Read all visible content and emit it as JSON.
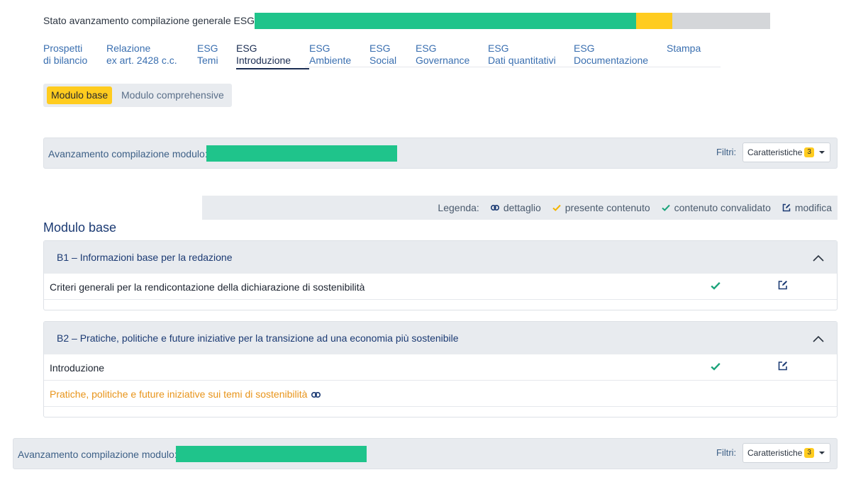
{
  "overall": {
    "label": "Stato avanzamento compilazione generale ESG:",
    "segments": [
      {
        "fraction": 0.74,
        "color": "#1fc48b"
      },
      {
        "fraction": 0.07,
        "color": "#ffcc1f"
      },
      {
        "fraction": 0.19,
        "color": "#d4d6d9"
      }
    ]
  },
  "nav": {
    "items": [
      {
        "line1": "Prospetti",
        "line2": "di bilancio"
      },
      {
        "line1": "Relazione",
        "line2": "ex art. 2428 c.c."
      },
      {
        "line1": "ESG",
        "line2": "Temi"
      },
      {
        "line1": "ESG",
        "line2": "Introduzione"
      },
      {
        "line1": "ESG",
        "line2": "Ambiente"
      },
      {
        "line1": "ESG",
        "line2": "Social"
      },
      {
        "line1": "ESG",
        "line2": "Governance"
      },
      {
        "line1": "ESG",
        "line2": "Dati quantitativi"
      },
      {
        "line1": "ESG",
        "line2": "Documentazione"
      },
      {
        "line1": "Stampa",
        "line2": ""
      }
    ],
    "active_index": 3
  },
  "module_switch": {
    "base_label": "Modulo base",
    "comprehensive_label": "Modulo comprehensive"
  },
  "module_progress": {
    "label": "Avanzamento compilazione modulo:",
    "filters_label": "Filtri:",
    "filter_value": "Caratteristiche",
    "filter_count": "3",
    "bar_color": "#1fc48b"
  },
  "legend": {
    "title": "Legenda:",
    "detail": "dettaglio",
    "present": "presente contenuto",
    "validated": "contenuto convalidato",
    "edit": "modifica"
  },
  "section": {
    "title": "Modulo base"
  },
  "cards": [
    {
      "title": "B1 – Informazioni base per la redazione",
      "rows": [
        {
          "text": "Criteri generali per la rendicontazione della dichiarazione di sostenibilità",
          "validated": true,
          "editable": true
        }
      ]
    },
    {
      "title": "B2 – Pratiche, politiche e future iniziative per la transizione ad una economia più sostenibile",
      "rows": [
        {
          "text": "Introduzione",
          "validated": true,
          "editable": true
        },
        {
          "text": "Pratiche, politiche e future iniziative sui temi di sostenibilità",
          "link": true
        }
      ]
    }
  ],
  "colors": {
    "accent_yellow": "#ffcc1f",
    "progress_green": "#1fc48b",
    "check_green": "#1aa37a",
    "navy": "#1b3a73",
    "link_orange": "#e8941a"
  }
}
